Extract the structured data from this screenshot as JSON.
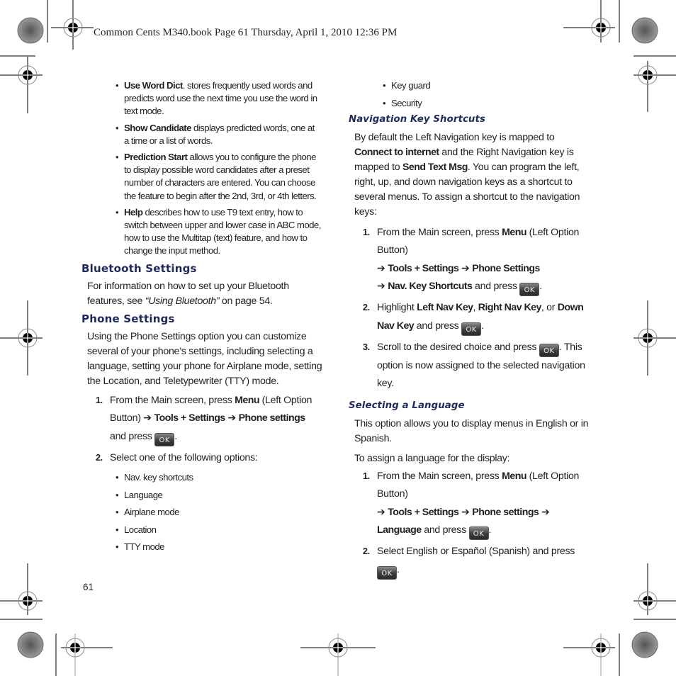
{
  "header": {
    "text": "Common Cents M340.book  Page 61  Thursday, April 1, 2010  12:36 PM"
  },
  "left_column": {
    "option_bullets": [
      {
        "term": "Use Word Dict",
        "sep": ".",
        "desc": " stores frequently used words and predicts word use the next time you use the word in text mode."
      },
      {
        "term": "Show Candidate",
        "sep": "",
        "desc": " displays predicted words, one at a time or a list of words."
      },
      {
        "term": "Prediction Start",
        "sep": "",
        "desc": " allows you to configure the phone to display possible word candidates after a preset number of characters are entered. You can choose the feature to begin after the 2nd, 3rd, or 4th letters."
      },
      {
        "term": "Help",
        "sep": "",
        "desc": " describes how to use T9 text entry, how to switch between upper and lower case in ABC mode, how to use the Multitap (text) feature, and how to change the input method."
      }
    ],
    "bluetooth": {
      "heading": "Bluetooth Settings",
      "text_before": "For information on how to set up your Bluetooth features, see ",
      "link_text": "“Using Bluetooth”",
      "text_after": " on page 54."
    },
    "phone": {
      "heading": "Phone Settings",
      "intro": "Using the Phone Settings option you can customize several of your phone’s settings, including selecting a language, setting your phone for Airplane mode, setting the Location, and Teletypewriter (TTY) mode.",
      "step1": {
        "num": "1.",
        "t1": "From the Main screen, press ",
        "menu": "Menu",
        "t2": " (Left Option Button) ",
        "arrow": "➔",
        "p1": "Tools + Settings",
        "p2": "Phone settings",
        "t3": " and press ",
        "ok": "OK",
        "end": "."
      },
      "step2": {
        "num": "2.",
        "text": "Select one of the following options:"
      },
      "options": [
        "Nav. key shortcuts",
        "Language",
        "Airplane mode",
        "Location",
        "TTY mode"
      ]
    },
    "page_number": "61"
  },
  "right_column": {
    "continued_bullets": [
      "Key guard",
      "Security"
    ],
    "nav": {
      "heading": "Navigation Key Shortcuts",
      "p_a": "By default the Left Navigation key is mapped to ",
      "p_b": "Connect to internet",
      "p_c": " and the Right Navigation key is mapped to ",
      "p_d": "Send Text Msg",
      "p_e": ". You can program the left, right, up, and down navigation keys as a shortcut to several menus. To assign a shortcut to the navigation keys:",
      "step1": {
        "num": "1.",
        "t1": "From the Main screen, press ",
        "menu": "Menu",
        "t2": " (Left Option Button) ",
        "arrow": "➔",
        "p1": "Tools + Settings",
        "p2": "Phone Settings",
        "p3": "Nav. Key Shortcuts",
        "t3": " and press ",
        "ok": "OK",
        "end": "."
      },
      "step2": {
        "num": "2.",
        "t1": "Highlight ",
        "k1": "Left Nav Key",
        "c1": ", ",
        "k2": "Right Nav Key",
        "c2": ", or ",
        "k3": "Down Nav Key",
        "t2": " and press ",
        "ok": "OK",
        "end": "."
      },
      "step3": {
        "num": "3.",
        "t1": "Scroll to the desired choice and press ",
        "ok": "OK",
        "t2": ". This option is now assigned to the selected navigation key."
      }
    },
    "language": {
      "heading": "Selecting a Language",
      "p1": "This option allows you to display menus in English or in Spanish.",
      "p2": "To assign a language for the display:",
      "step1": {
        "num": "1.",
        "t1": "From the Main screen, press ",
        "menu": "Menu",
        "t2": " (Left Option Button) ",
        "arrow": "➔",
        "p1": "Tools + Settings",
        "p2": "Phone settings",
        "p3": "Language",
        "t3": " and press ",
        "ok": "OK",
        "end": "."
      },
      "step2": {
        "num": "2.",
        "t1": "Select English or Español (Spanish) and press ",
        "ok": "OK",
        "end": "."
      }
    }
  }
}
